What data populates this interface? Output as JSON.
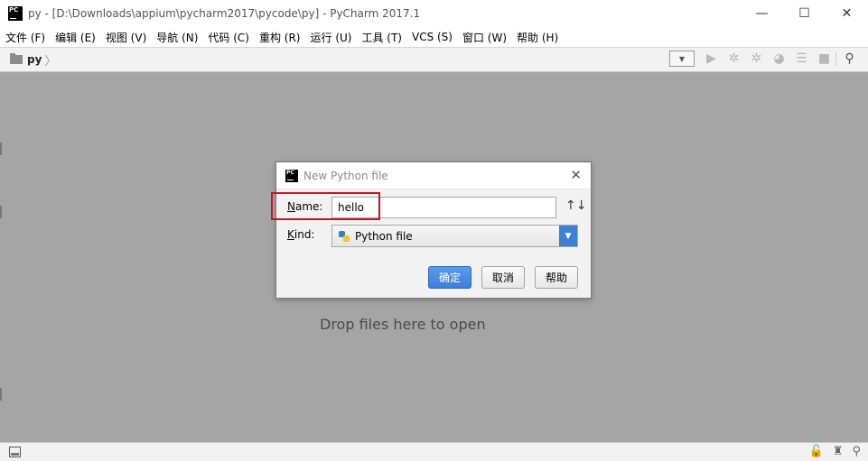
{
  "window": {
    "title": "py - [D:\\Downloads\\appium\\pycharm2017\\pycode\\py] - PyCharm 2017.1",
    "logo_text": "PC",
    "minimize": "—",
    "maximize": "☐",
    "close": "✕"
  },
  "menubar": {
    "items": [
      {
        "label": "文件 (F)"
      },
      {
        "label": "编辑 (E)"
      },
      {
        "label": "视图 (V)"
      },
      {
        "label": "导航 (N)"
      },
      {
        "label": "代码 (C)"
      },
      {
        "label": "重构 (R)"
      },
      {
        "label": "运行 (U)"
      },
      {
        "label": "工具 (T)"
      },
      {
        "label": "VCS (S)"
      },
      {
        "label": "窗口 (W)"
      },
      {
        "label": "帮助 (H)"
      }
    ]
  },
  "navbar": {
    "breadcrumb": "py",
    "breadcrumb_arrow": "〉",
    "combo_arrow": "▼",
    "tools": [
      {
        "icon": "run-icon",
        "glyph": "▶"
      },
      {
        "icon": "debug-icon",
        "glyph": "✲"
      },
      {
        "icon": "coverage-icon",
        "glyph": "✲"
      },
      {
        "icon": "profile-icon",
        "glyph": "◕"
      },
      {
        "icon": "concurrency-icon",
        "glyph": "☰"
      },
      {
        "icon": "stop-icon",
        "glyph": "■"
      }
    ],
    "search_glyph": "⚲"
  },
  "workspace": {
    "drop_text": "Drop files here to open"
  },
  "dialog": {
    "title": "New Python file",
    "close": "✕",
    "name_label_prefix": "N",
    "name_label_rest": "ame:",
    "name_value": "hello",
    "sort_glyph": "↑↓",
    "kind_label_prefix": "K",
    "kind_label_rest": "ind:",
    "kind_value": "Python file",
    "kind_arrow": "▼",
    "ok_label": "确定",
    "cancel_label": "取消",
    "help_label": "帮助"
  },
  "statusbar": {
    "lock_glyph": "🔓",
    "inspector_glyph": "♜",
    "search_glyph": "⚲"
  },
  "colors": {
    "workspace_bg": "#a5a5a5",
    "primary_button": "#3f7fd6",
    "highlight_box": "#d0121b"
  }
}
